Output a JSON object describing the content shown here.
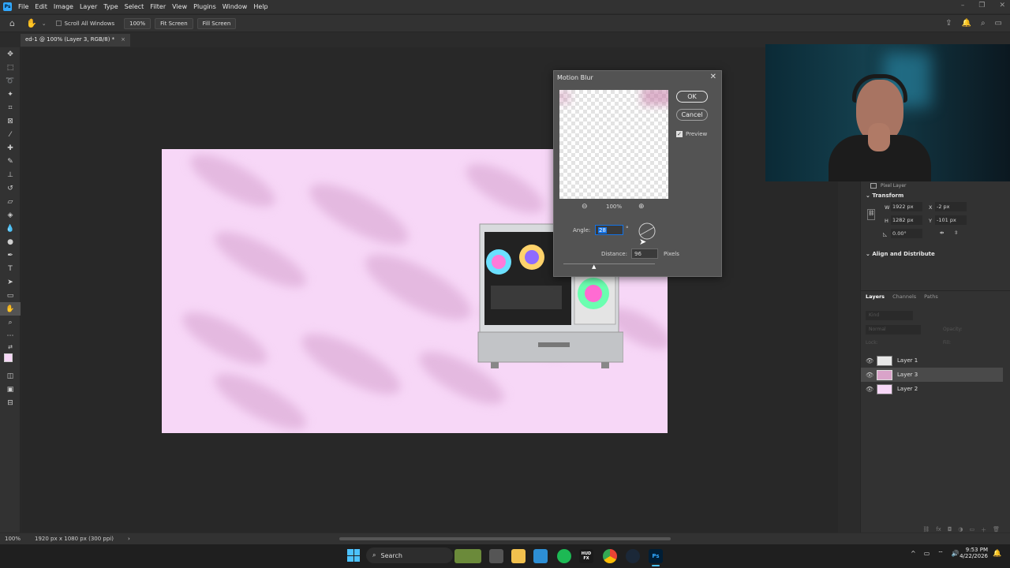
{
  "menubar": {
    "logo": "Ps",
    "items": [
      "File",
      "Edit",
      "Image",
      "Layer",
      "Type",
      "Select",
      "Filter",
      "View",
      "Window",
      "Plugins",
      "Window",
      "Help"
    ]
  },
  "options": {
    "scroll_all_label": "Scroll All Windows",
    "zoom_btn": "100%",
    "fit_screen": "Fit Screen",
    "fill_screen": "Fill Screen"
  },
  "document": {
    "tab_title": "ed-1 @ 100% (Layer 3, RGB/8) *",
    "tab_close": "×"
  },
  "dialog": {
    "title": "Motion Blur",
    "ok": "OK",
    "cancel": "Cancel",
    "preview_label": "Preview",
    "preview_checked": true,
    "zoom": "100%",
    "angle_label": "Angle:",
    "angle_value": "28",
    "angle_unit": "°",
    "distance_label": "Distance:",
    "distance_value": "96",
    "distance_unit": "Pixels"
  },
  "properties": {
    "layer_type": "Pixel Layer",
    "transform_label": "Transform",
    "w_label": "W",
    "w_value": "1922 px",
    "h_label": "H",
    "h_value": "1282 px",
    "x_label": "X",
    "x_value": "-2 px",
    "y_label": "Y",
    "y_value": "-101 px",
    "angle_value": "0.00°",
    "align_label": "Align and Distribute"
  },
  "layers_panel": {
    "tabs": [
      "Layers",
      "Channels",
      "Paths"
    ],
    "kind_placeholder": "Kind",
    "blend_mode": "Normal",
    "opacity_label": "Opacity:",
    "lock_label": "Lock:",
    "fill_label": "Fill:",
    "layers": [
      {
        "name": "Layer 1",
        "selected": false
      },
      {
        "name": "Layer 3",
        "selected": true
      },
      {
        "name": "Layer 2",
        "selected": false
      }
    ]
  },
  "status": {
    "zoom": "100%",
    "doc_size": "1920 px x 1080 px (300 ppi)"
  },
  "taskbar": {
    "search_label": "Search",
    "time": "9:53 PM",
    "date": "4/22/2026",
    "hud_icon": "HUD FX",
    "ps_icon": "Ps"
  },
  "colors": {
    "canvas_bg": "#f7d7f7",
    "ps_blue": "#31a8ff",
    "accent": "#1473e6"
  }
}
